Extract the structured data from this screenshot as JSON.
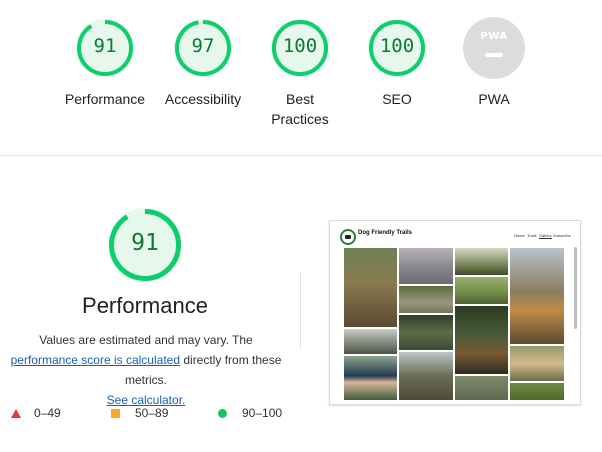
{
  "categories": [
    {
      "label": "Performance",
      "score": "91",
      "value": 91
    },
    {
      "label": "Accessibility",
      "score": "97",
      "value": 97
    },
    {
      "label": "Best Practices",
      "score": "100",
      "value": 100
    },
    {
      "label": "SEO",
      "score": "100",
      "value": 100
    },
    {
      "label": "PWA",
      "badge": "PWA"
    }
  ],
  "performance": {
    "score": "91",
    "value": 91,
    "title": "Performance",
    "desc_before": "Values are estimated and may vary. The ",
    "link_score": "performance score is calculated",
    "desc_middle": " directly from these metrics. ",
    "link_calc": "See calculator."
  },
  "legend": {
    "fail": "0–49",
    "average": "50–89",
    "pass": "90–100"
  },
  "thumbnail": {
    "site_title": "Dog Friendly Trails",
    "nav": [
      "Home",
      "Trails",
      "Gallery",
      "Subscribe"
    ],
    "active_nav": "Gallery"
  },
  "colors": {
    "pass": "#0cce6b",
    "pass_text": "#0c7a37",
    "fail": "#e53935",
    "average": "#f9a825",
    "pwa_gray": "#dcdcdc"
  }
}
